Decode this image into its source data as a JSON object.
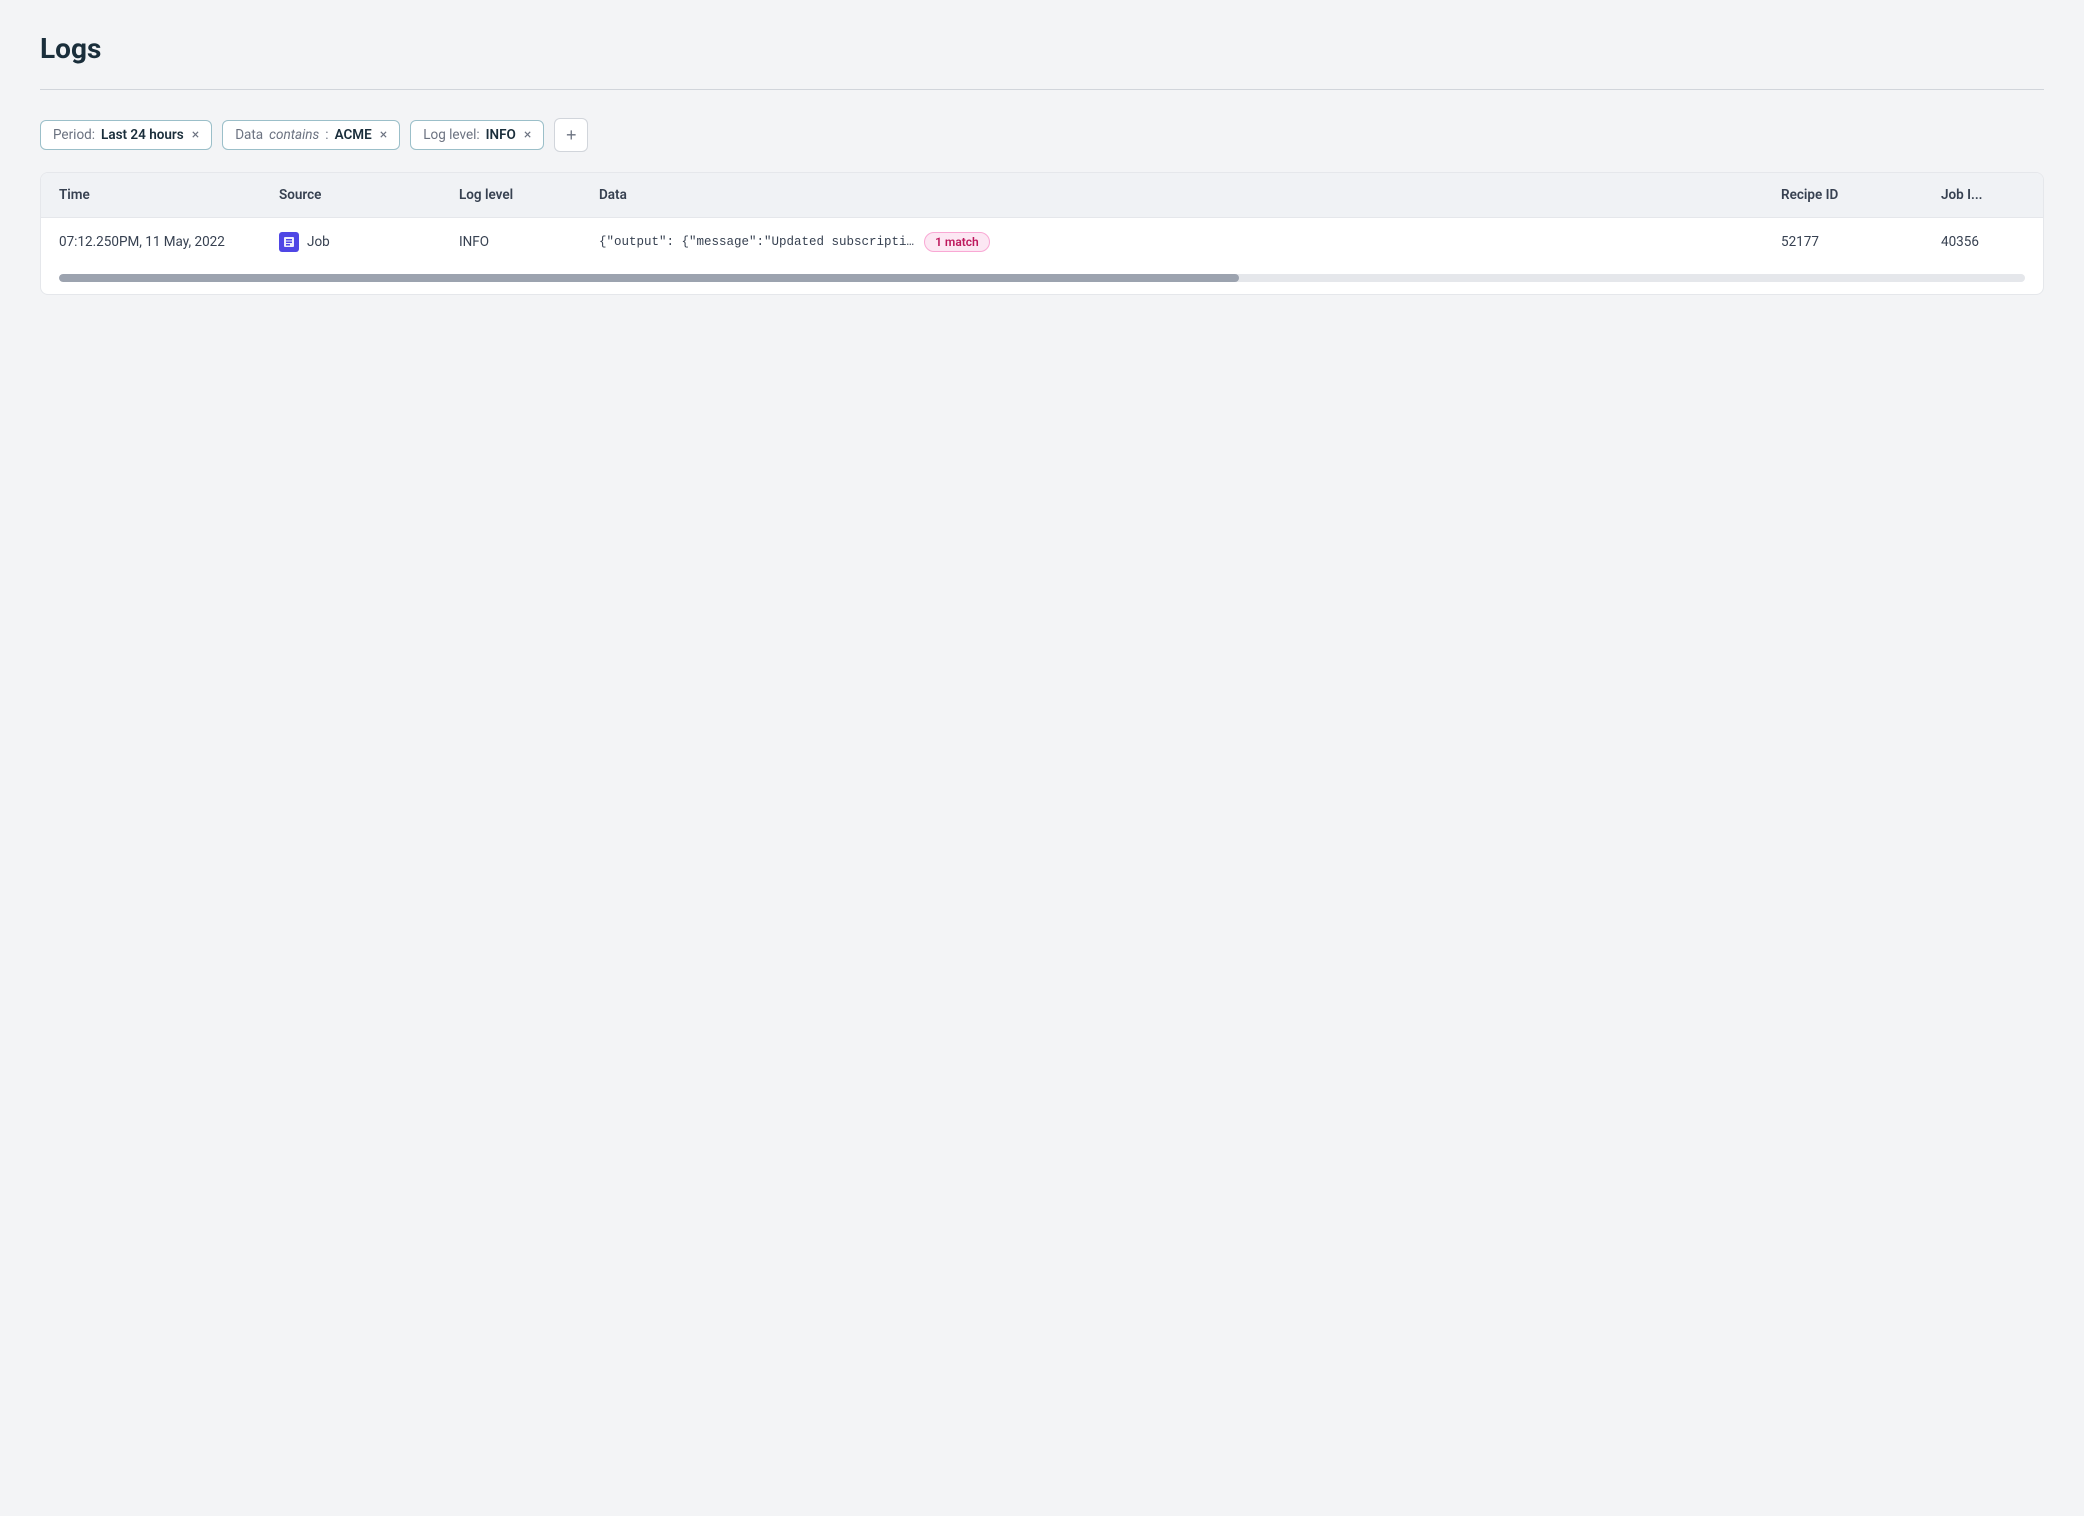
{
  "page": {
    "title": "Logs"
  },
  "filters": {
    "period": {
      "label": "Period:",
      "value": "Last 24 hours"
    },
    "data": {
      "label": "Data",
      "operator": "contains",
      "colon": ":",
      "value": "ACME"
    },
    "loglevel": {
      "label": "Log level:",
      "value": "INFO"
    },
    "add_label": "+"
  },
  "table": {
    "columns": [
      {
        "key": "time",
        "label": "Time"
      },
      {
        "key": "source",
        "label": "Source"
      },
      {
        "key": "loglevel",
        "label": "Log level"
      },
      {
        "key": "data",
        "label": "Data"
      },
      {
        "key": "recipeid",
        "label": "Recipe ID"
      },
      {
        "key": "jobid",
        "label": "Job I..."
      }
    ],
    "rows": [
      {
        "time": "07:12.250PM, 11 May, 2022",
        "source": "Job",
        "loglevel": "INFO",
        "data": "{\"output\": {\"message\":\"Updated subscripti…",
        "match_count": "1",
        "match_label": "match",
        "recipeid": "52177",
        "jobid": "40356"
      }
    ]
  }
}
